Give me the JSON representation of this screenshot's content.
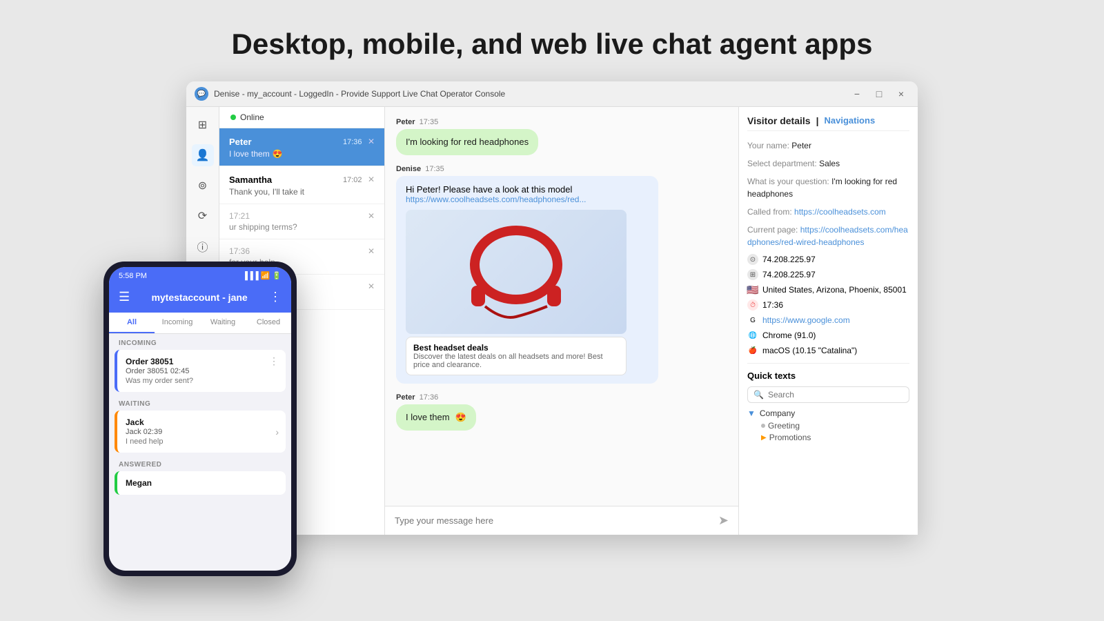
{
  "page": {
    "title": "Desktop, mobile, and web live chat agent apps"
  },
  "window": {
    "titlebar": "Denise - my_account - LoggedIn -  Provide Support Live Chat Operator Console",
    "status": "Online",
    "minimize": "−",
    "maximize": "□",
    "close": "×"
  },
  "chat_list": {
    "peter": {
      "name": "Peter",
      "time": "17:36",
      "preview": "I love them",
      "emoji": "😍"
    },
    "samantha": {
      "name": "Samantha",
      "time": "17:02",
      "preview": "Thank you, I'll take it"
    }
  },
  "chat_messages": {
    "peter_question": {
      "sender": "Peter",
      "time": "17:35",
      "text": "I'm looking for red headphones"
    },
    "denise_reply": {
      "sender": "Denise",
      "time": "17:35",
      "text": "Hi Peter! Please have a look at this model"
    },
    "denise_link": "https://www.coolheadsets.com/headphones/red...",
    "product_title": "Best headset deals",
    "product_desc": "Discover the latest deals on all headsets and more! Best price and clearance.",
    "peter_love": {
      "sender": "Peter",
      "time": "17:36",
      "text": "I love them",
      "emoji": "😍"
    },
    "input_placeholder": "Type your message here"
  },
  "visitor_details": {
    "header": "Visitor details",
    "nav": "Navigations",
    "your_name_label": "Your name:",
    "your_name_value": "Peter",
    "department_label": "Select department:",
    "department_value": "Sales",
    "question_label": "What is your question:",
    "question_value": "I'm looking for red headphones",
    "called_from_label": "Called from:",
    "called_from_value": "https://coolheadsets.com",
    "current_page_label": "Current page:",
    "current_page_value": "https://coolheadsets.com/headphones/red-wired-headphones",
    "ip1": "74.208.225.97",
    "ip2": "74.208.225.97",
    "location": "United States, Arizona, Phoenix, 85001",
    "time": "17:36",
    "referrer": "https://www.google.com",
    "browser": "Chrome (91.0)",
    "os": "macOS (10.15 \"Catalina\")"
  },
  "quick_texts": {
    "header": "Quick texts",
    "search_placeholder": "Search",
    "company_label": "Company",
    "greeting_label": "Greeting",
    "promotions_label": "Promotions"
  },
  "mobile": {
    "time": "5:58 PM",
    "account": "mytestaccount - jane",
    "tabs": [
      "All",
      "Incoming",
      "Waiting",
      "Closed"
    ],
    "incoming_label": "INCOMING",
    "order_name": "Order 38051",
    "order_sub": "Order 38051 02:45",
    "order_msg": "Was my order sent?",
    "waiting_label": "WAITING",
    "jack_name": "Jack",
    "jack_sub": "Jack 02:39",
    "jack_msg": "I need help",
    "answered_label": "ANSWERED",
    "megan_name": "Megan"
  }
}
